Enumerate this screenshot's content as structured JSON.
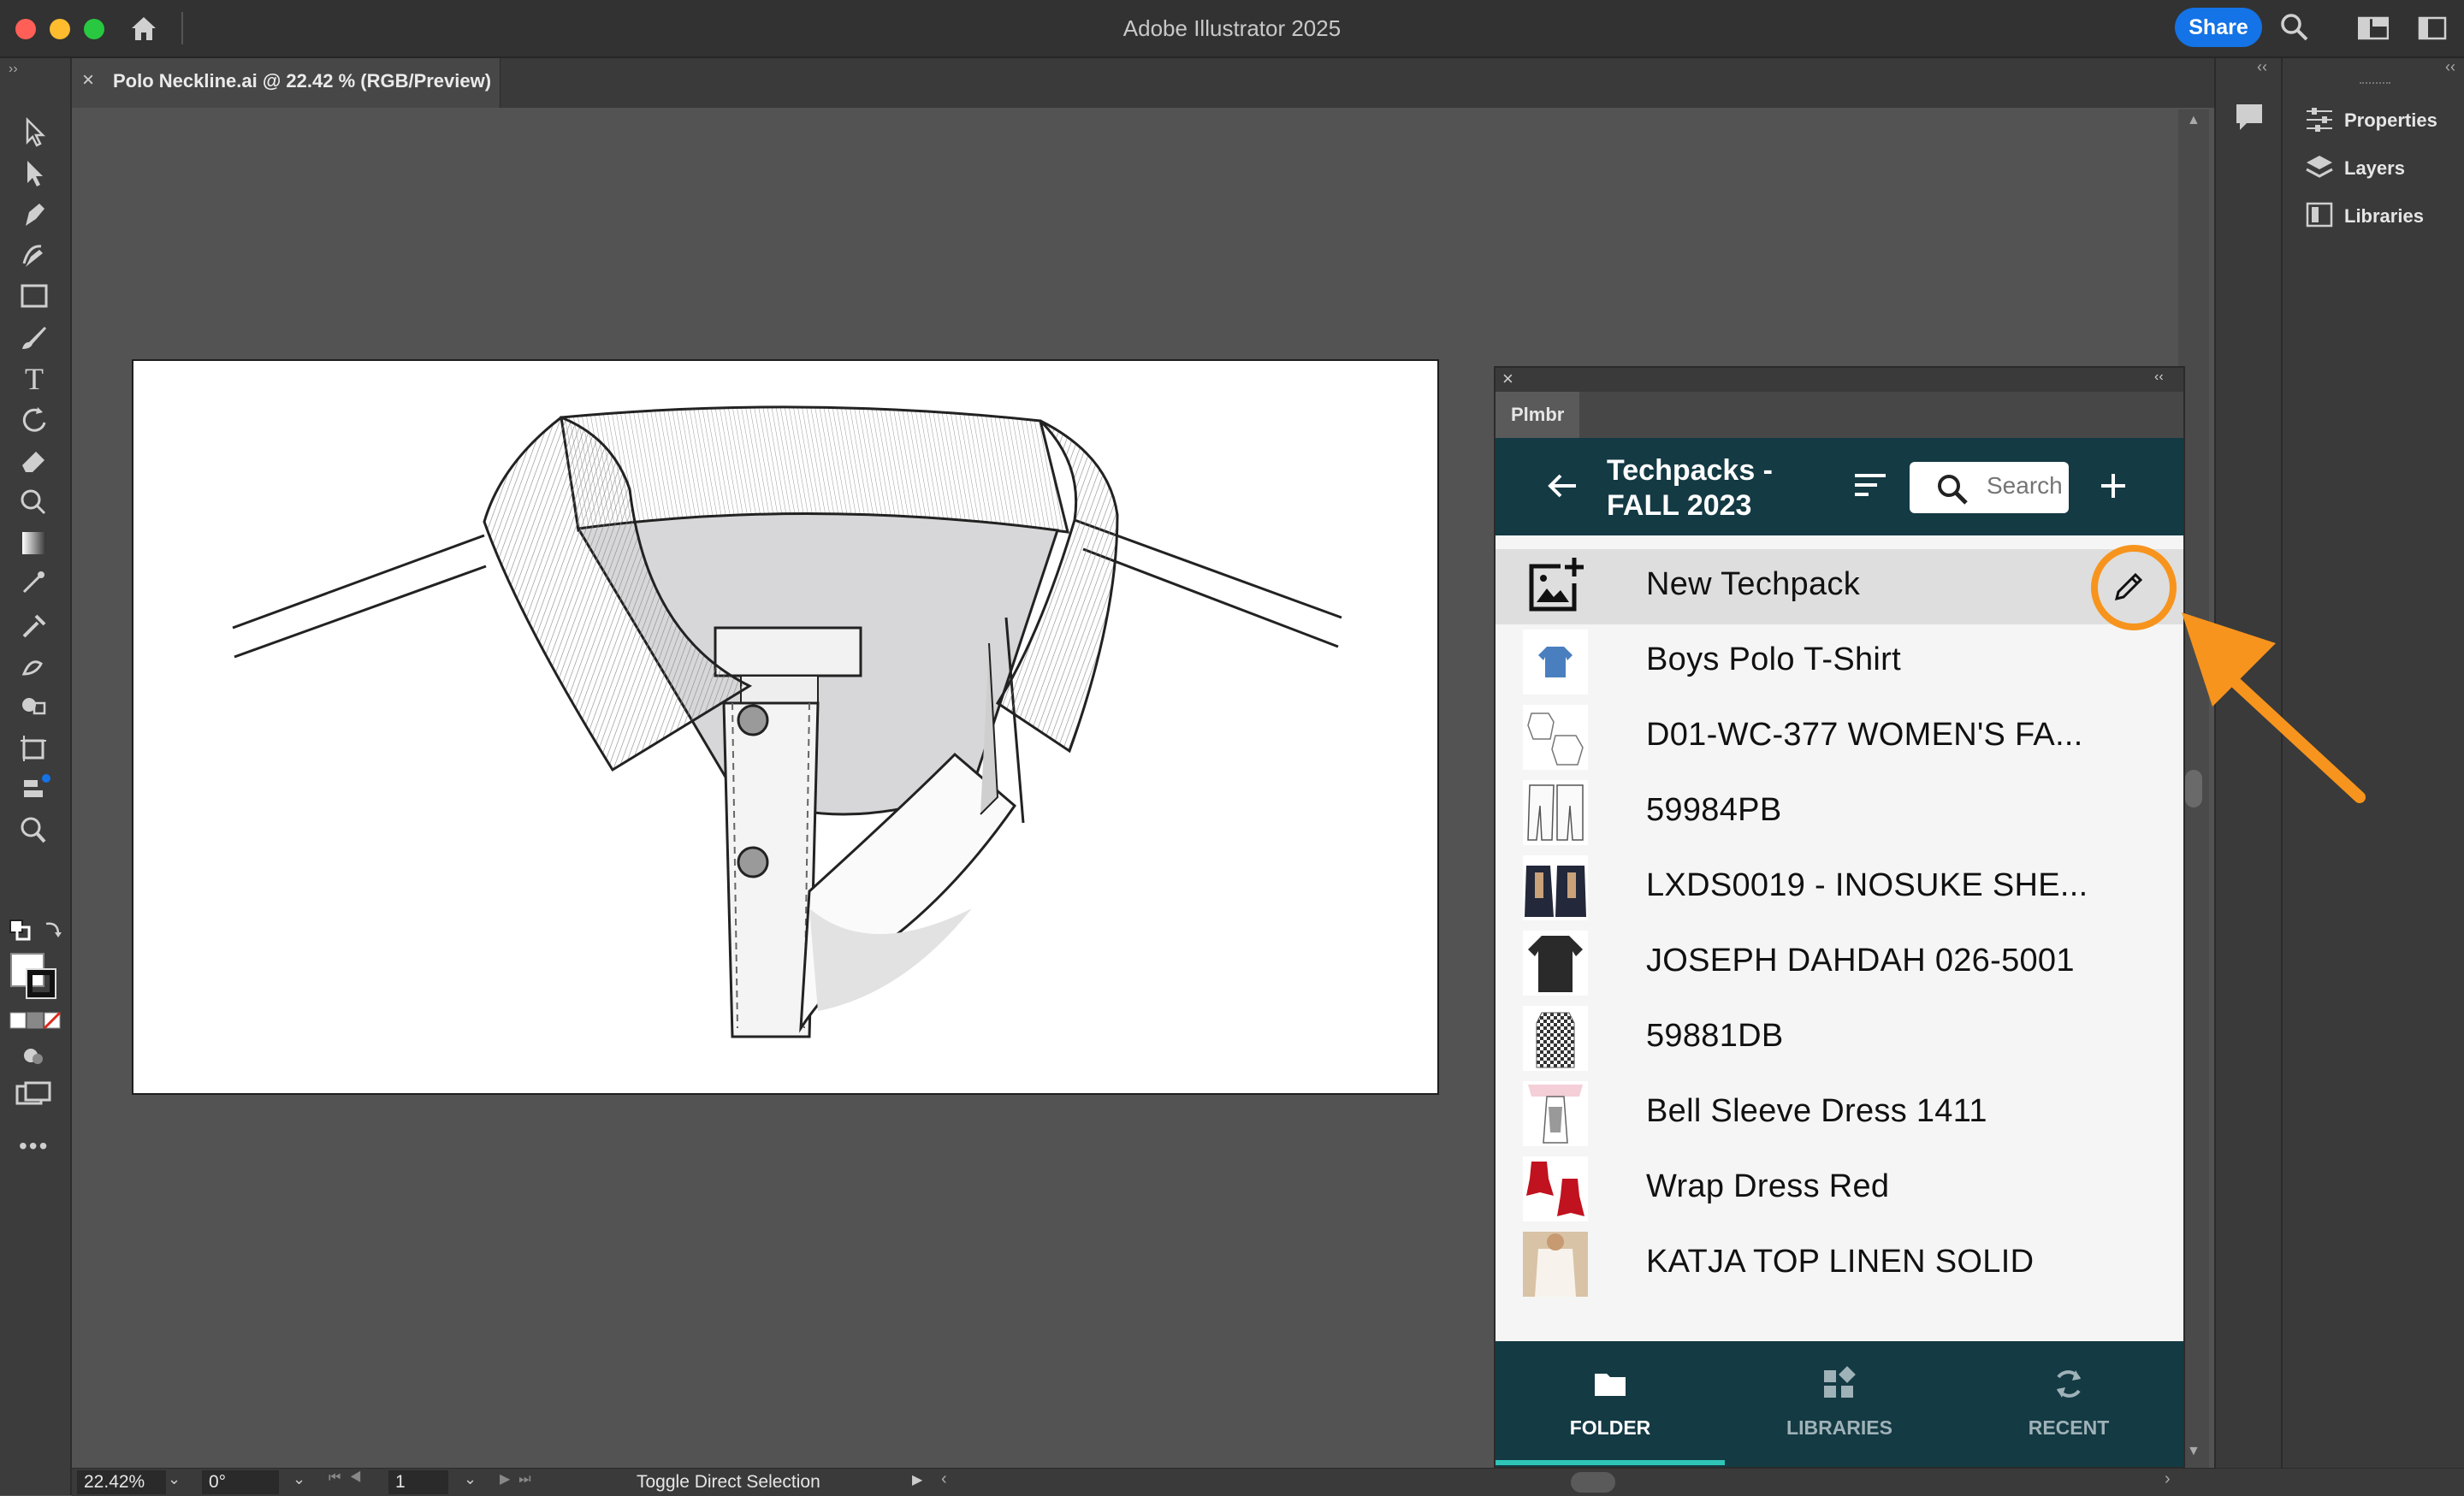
{
  "app": {
    "title": "Adobe Illustrator 2025",
    "share_label": "Share"
  },
  "document": {
    "tab_label": "Polo Neckline.ai @ 22.42 % (RGB/Preview)"
  },
  "right_panel": {
    "items": [
      {
        "label": "Properties",
        "icon": "sliders-icon"
      },
      {
        "label": "Layers",
        "icon": "layers-icon"
      },
      {
        "label": "Libraries",
        "icon": "libraries-icon"
      }
    ]
  },
  "plugin": {
    "tab_label": "Plmbr",
    "folder_title": "Techpacks - FALL 2023",
    "search_placeholder": "Search",
    "items": [
      {
        "label": "New Techpack",
        "thumb": "add-image-icon"
      },
      {
        "label": "Boys Polo T-Shirt",
        "thumb": "blue-polo"
      },
      {
        "label": "D01-WC-377 WOMEN'S FA...",
        "thumb": "white-shirts"
      },
      {
        "label": "59984PB",
        "thumb": "white-shorts"
      },
      {
        "label": "LXDS0019 - INOSUKE SHE...",
        "thumb": "dark-jackets"
      },
      {
        "label": "JOSEPH DAHDAH 026-5001",
        "thumb": "black-tee"
      },
      {
        "label": "59881DB",
        "thumb": "checked-top"
      },
      {
        "label": "Bell Sleeve Dress 1411",
        "thumb": "bell-dress"
      },
      {
        "label": "Wrap Dress Red",
        "thumb": "red-dresses"
      },
      {
        "label": "KATJA TOP LINEN SOLID",
        "thumb": "linen-top-photo"
      }
    ],
    "nav": [
      {
        "label": "FOLDER",
        "icon": "folder-icon",
        "active": true
      },
      {
        "label": "LIBRARIES",
        "icon": "libraries-grid-icon",
        "active": false
      },
      {
        "label": "RECENT",
        "icon": "refresh-icon",
        "active": false
      }
    ]
  },
  "status": {
    "zoom": "22.42%",
    "rotation": "0°",
    "artboard": "1",
    "message": "Toggle Direct Selection"
  },
  "colors": {
    "accent": "#1473e6",
    "plugin_header": "#143a44",
    "highlight": "#f7941d"
  }
}
